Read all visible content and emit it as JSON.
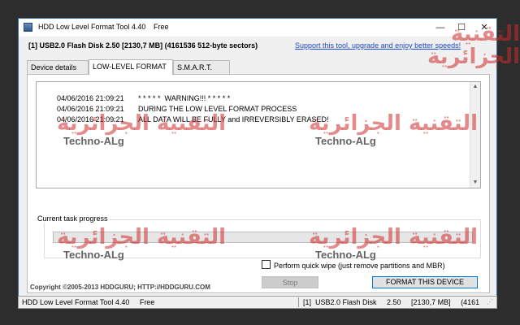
{
  "window": {
    "title": "HDD Low Level Format Tool 4.40",
    "title_suffix": "Free",
    "controls": [
      "—",
      "☐",
      "✕"
    ]
  },
  "info": {
    "device_line": "[1]  USB2.0 Flash Disk    2.50    [2130,7 MB]    (4161536 512-byte sectors)",
    "support_link": "Support this tool, upgrade and enjoy better speeds!"
  },
  "tabs": [
    {
      "label": "Device details",
      "active": false
    },
    {
      "label": "LOW-LEVEL FORMAT",
      "active": true
    },
    {
      "label": "S.M.A.R.T.",
      "active": false
    }
  ],
  "log": [
    {
      "time": "04/06/2016 21:09:21",
      "message": "* * * * *  WARNING!!! * * * * *"
    },
    {
      "time": "04/06/2016 21:09:21",
      "message": "DURING THE LOW LEVEL FORMAT PROCESS"
    },
    {
      "time": "04/06/2016 21:09:21",
      "message": "ALL DATA WILL BE FULLY and IRREVERSIBLY ERASED!"
    }
  ],
  "progress": {
    "label": "Current task progress",
    "value_percent": 0
  },
  "options": {
    "quick_wipe_label": "Perform quick wipe (just remove partitions and MBR)",
    "quick_wipe_checked": false
  },
  "buttons": {
    "stop": "Stop",
    "format": "FORMAT THIS DEVICE"
  },
  "copyright": "Copyright ©2005-2013 HDDGURU;   HTTP://HDDGURU.COM",
  "statusbar": {
    "left": "HDD Low Level Format Tool 4.40     Free",
    "right": "[1]  USB2.0 Flash Disk     2.50     [2130,7 MB]     (4161"
  },
  "watermark": {
    "arabic": "التقنية الجزائرية",
    "latin": "Techno-ALg"
  },
  "colors": {
    "accent": "#0078d7",
    "link": "#1a47c8",
    "progress": "#06b025",
    "watermark": "#cd2a2a"
  }
}
